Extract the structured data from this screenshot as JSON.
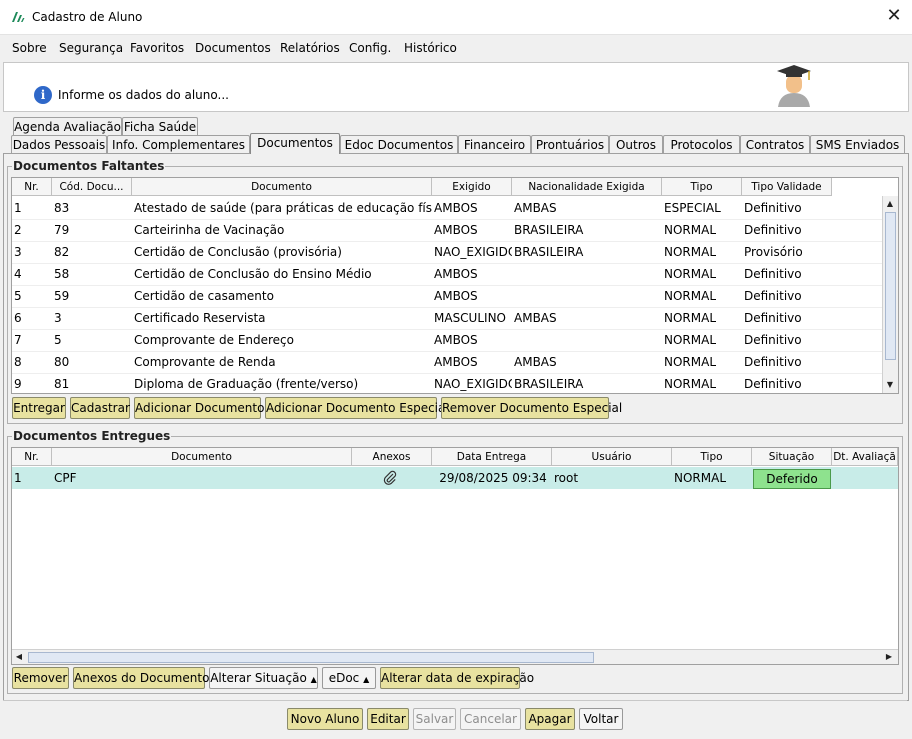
{
  "window": {
    "title": "Cadastro de Aluno"
  },
  "menu": [
    "Sobre",
    "Segurança",
    "Favoritos",
    "Documentos",
    "Relatórios",
    "Config.",
    "Histórico"
  ],
  "header": {
    "message": "Informe os dados do aluno..."
  },
  "tabs_row1": [
    "Agenda Avaliação",
    "Ficha Saúde"
  ],
  "tabs_row2": [
    "Dados Pessoais",
    "Info. Complementares",
    "Documentos",
    "Edoc Documentos",
    "Financeiro",
    "Prontuários",
    "Outros",
    "Protocolos",
    "Contratos",
    "SMS Enviados"
  ],
  "active_tab": "Documentos",
  "faltantes": {
    "title": "Documentos Faltantes",
    "columns": [
      "Nr.",
      "Cód. Docu...",
      "Documento",
      "Exigido",
      "Nacionalidade Exigida",
      "Tipo",
      "Tipo Validade"
    ],
    "rows": [
      [
        "1",
        "83",
        "Atestado de saúde (para práticas de educação física)",
        "AMBOS",
        "AMBAS",
        "ESPECIAL",
        "Definitivo"
      ],
      [
        "2",
        "79",
        "Carteirinha de Vacinação",
        "AMBOS",
        "BRASILEIRA",
        "NORMAL",
        "Definitivo"
      ],
      [
        "3",
        "82",
        "Certidão de Conclusão (provisória)",
        "NAO_EXIGIDO",
        "BRASILEIRA",
        "NORMAL",
        "Provisório"
      ],
      [
        "4",
        "58",
        "Certidão de Conclusão do Ensino Médio",
        "AMBOS",
        "",
        "NORMAL",
        "Definitivo"
      ],
      [
        "5",
        "59",
        "Certidão de casamento",
        "AMBOS",
        "",
        "NORMAL",
        "Definitivo"
      ],
      [
        "6",
        "3",
        "Certificado Reservista",
        "MASCULINO",
        "AMBAS",
        "NORMAL",
        "Definitivo"
      ],
      [
        "7",
        "5",
        "Comprovante de Endereço",
        "AMBOS",
        "",
        "NORMAL",
        "Definitivo"
      ],
      [
        "8",
        "80",
        "Comprovante de Renda",
        "AMBOS",
        "AMBAS",
        "NORMAL",
        "Definitivo"
      ],
      [
        "9",
        "81",
        "Diploma de Graduação (frente/verso)",
        "NAO_EXIGIDO",
        "BRASILEIRA",
        "NORMAL",
        "Definitivo"
      ]
    ],
    "buttons": [
      "Entregar",
      "Cadastrar",
      "Adicionar Documento",
      "Adicionar Documento Especial",
      "Remover Documento Especial"
    ]
  },
  "entregues": {
    "title": "Documentos Entregues",
    "columns": [
      "Nr.",
      "Documento",
      "Anexos",
      "Data Entrega",
      "Usuário",
      "Tipo",
      "Situação",
      "Dt. Avaliaçã"
    ],
    "rows": [
      [
        "1",
        "CPF",
        "",
        "29/08/2025 09:34",
        "root",
        "NORMAL",
        "Deferido",
        ""
      ]
    ],
    "buttons": [
      "Remover",
      "Anexos do Documento",
      "Alterar Situação",
      "eDoc",
      "Alterar data de expiração"
    ]
  },
  "footer_buttons": [
    "Novo Aluno",
    "Editar",
    "Salvar",
    "Cancelar",
    "Apagar",
    "Voltar"
  ],
  "colors": {
    "selected_row": "#c8ece8",
    "deferido": "#8ee28e",
    "button": "#e8e2a0"
  }
}
